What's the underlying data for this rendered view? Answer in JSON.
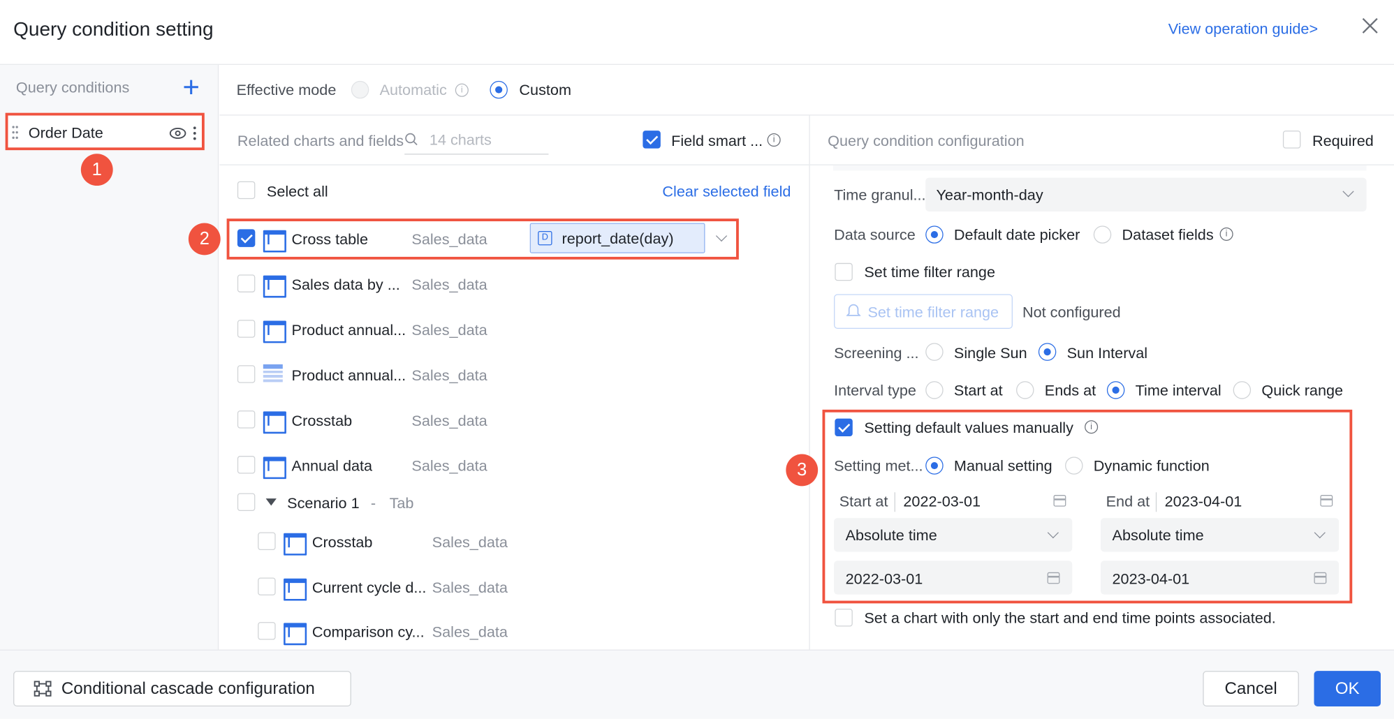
{
  "dialog": {
    "title": "Query condition setting",
    "guide_link": "View operation guide>"
  },
  "left": {
    "header": "Query conditions",
    "item": "Order Date"
  },
  "mode": {
    "label": "Effective mode",
    "automatic": "Automatic",
    "custom": "Custom"
  },
  "charts": {
    "header": "Related charts and fields",
    "search_placeholder": "14 charts",
    "smart_label": "Field smart ...",
    "select_all": "Select all",
    "clear": "Clear selected field",
    "rows": [
      {
        "name": "Cross table",
        "source": "Sales_data",
        "field": "report_date(day)"
      },
      {
        "name": "Sales data by ...",
        "source": "Sales_data"
      },
      {
        "name": "Product annual...",
        "source": "Sales_data"
      },
      {
        "name": "Product annual...",
        "source": "Sales_data"
      },
      {
        "name": "Crosstab",
        "source": "Sales_data"
      },
      {
        "name": "Annual data",
        "source": "Sales_data"
      }
    ],
    "group": {
      "name": "Scenario 1",
      "sep": "-",
      "tag": "Tab"
    },
    "sub_rows": [
      {
        "name": "Crosstab",
        "source": "Sales_data"
      },
      {
        "name": "Current cycle d...",
        "source": "Sales_data"
      },
      {
        "name": "Comparison cy...",
        "source": "Sales_data"
      }
    ]
  },
  "config": {
    "header": "Query condition configuration",
    "required": "Required",
    "time_gran_label": "Time granul...",
    "time_gran_value": "Year-month-day",
    "ds_label": "Data source",
    "ds_default": "Default date picker",
    "ds_fields": "Dataset fields",
    "set_range": "Set time filter range",
    "set_range_btn": "Set time filter range",
    "not_configured": "Not configured",
    "screening_label": "Screening ...",
    "single": "Single Sun",
    "interval": "Sun Interval",
    "itype_label": "Interval type",
    "start_at": "Start at",
    "ends_at": "Ends at",
    "time_interval": "Time interval",
    "quick": "Quick range",
    "default_manual": "Setting default values manually",
    "method_label": "Setting met...",
    "manual": "Manual setting",
    "dynamic": "Dynamic function",
    "start_label": "Start at",
    "start_value": "2022-03-01",
    "end_label": "End at",
    "end_value": "2023-04-01",
    "abs1": "Absolute time",
    "abs2": "Absolute time",
    "date1": "2022-03-01",
    "date2": "2023-04-01",
    "only_points": "Set a chart with only the start and end time points associated."
  },
  "footer": {
    "cascade": "Conditional cascade configuration",
    "cancel": "Cancel",
    "ok": "OK"
  },
  "badges": [
    "1",
    "2",
    "3"
  ]
}
